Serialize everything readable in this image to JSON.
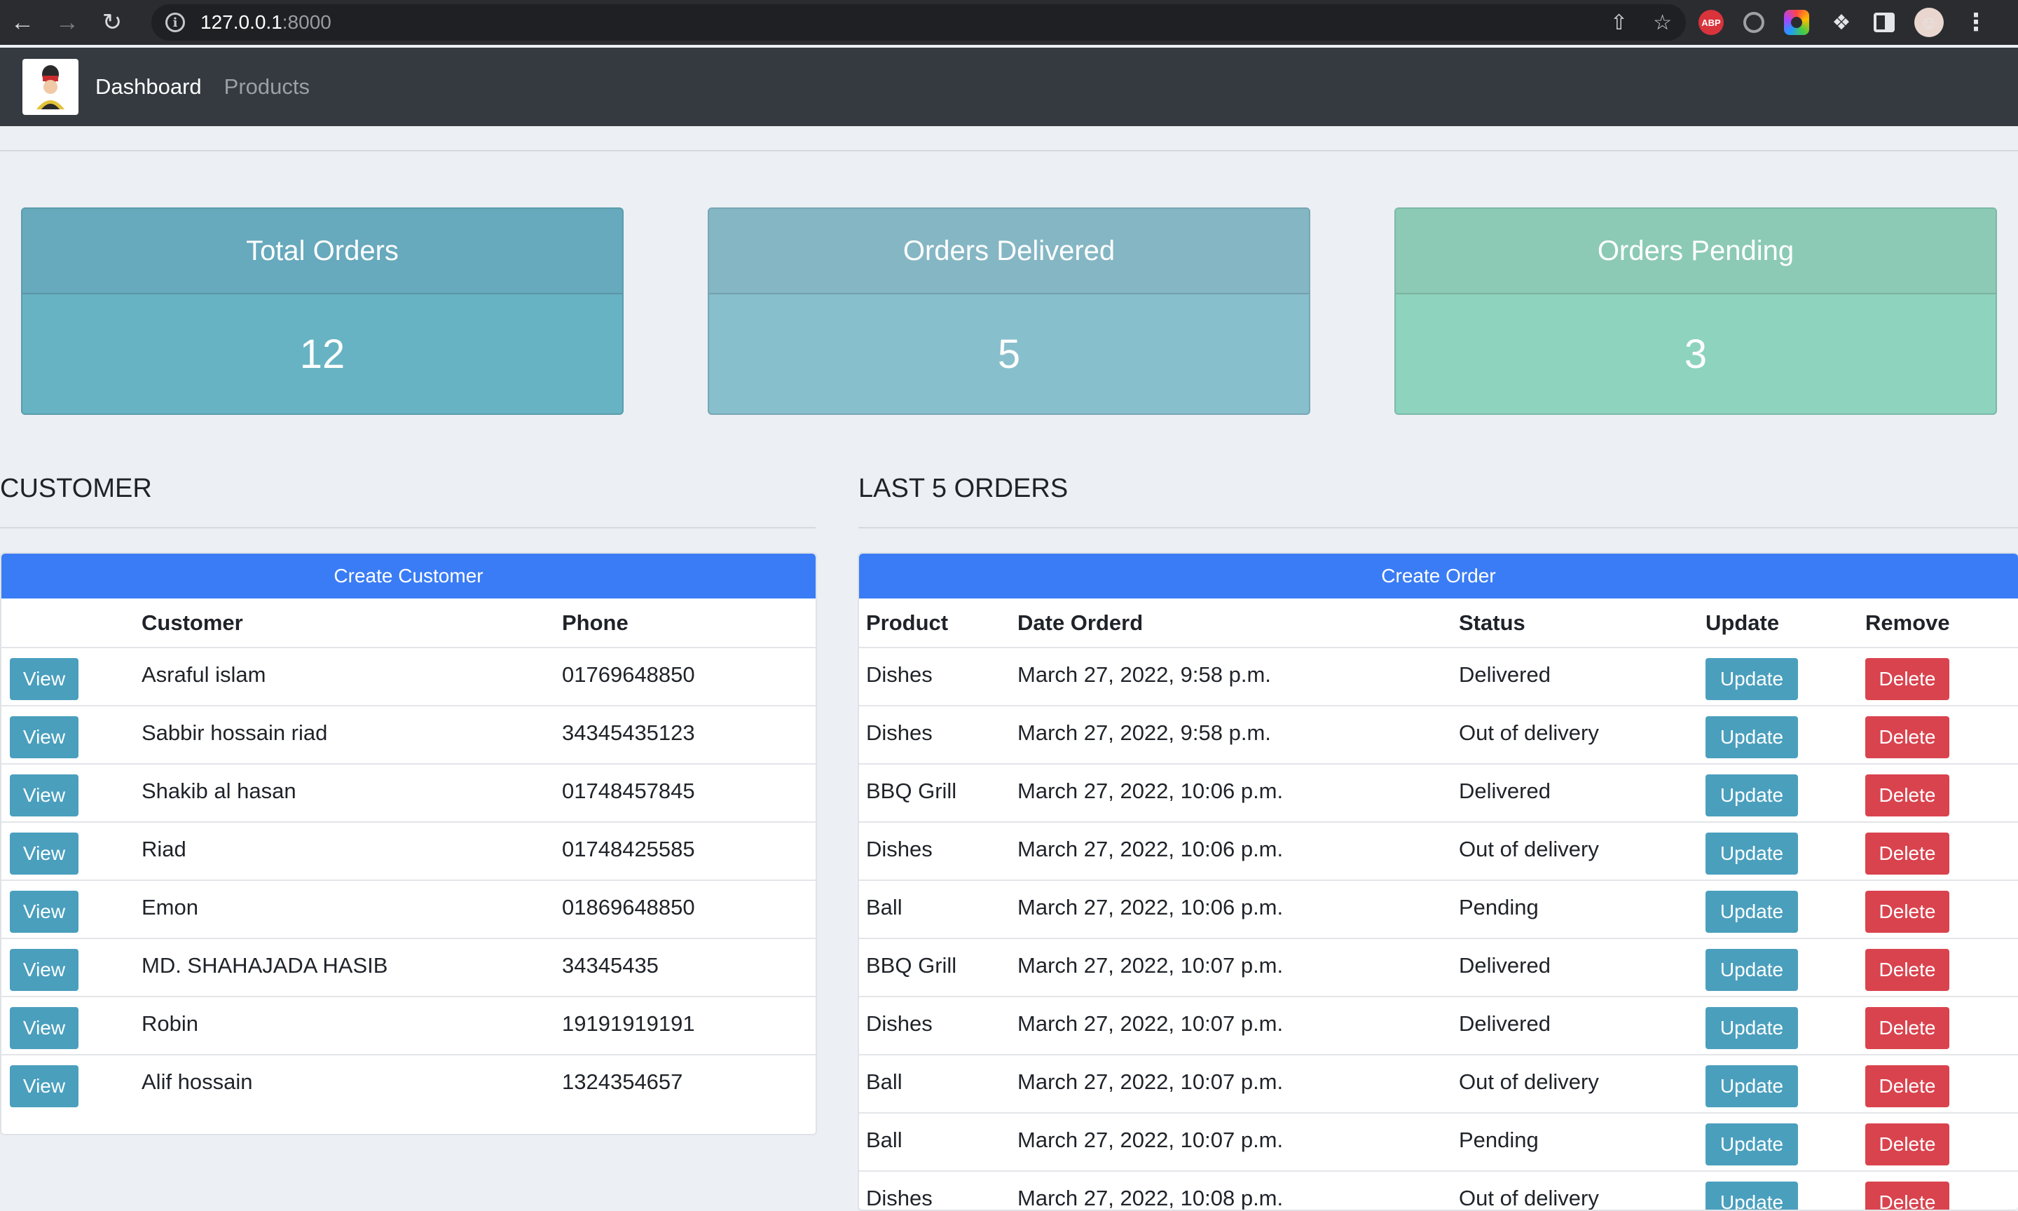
{
  "browser": {
    "url_host": "127.0.0.1",
    "url_port": ":8000",
    "abp_label": "ABP"
  },
  "navbar": {
    "links": [
      "Dashboard",
      "Products"
    ]
  },
  "stats": [
    {
      "title": "Total Orders",
      "value": "12"
    },
    {
      "title": "Orders Delivered",
      "value": "5"
    },
    {
      "title": "Orders Pending",
      "value": "3"
    }
  ],
  "customers": {
    "heading": "CUSTOMER",
    "create_label": "Create Customer",
    "columns": [
      "",
      "Customer",
      "Phone"
    ],
    "view_label": "View",
    "rows": [
      {
        "name": "Asraful islam",
        "phone": "01769648850"
      },
      {
        "name": "Sabbir hossain riad",
        "phone": "34345435123"
      },
      {
        "name": "Shakib al hasan",
        "phone": "01748457845"
      },
      {
        "name": "Riad",
        "phone": "01748425585"
      },
      {
        "name": "Emon",
        "phone": "01869648850"
      },
      {
        "name": "MD. SHAHAJADA HASIB",
        "phone": "34345435"
      },
      {
        "name": "Robin",
        "phone": "19191919191"
      },
      {
        "name": "Alif hossain",
        "phone": "1324354657"
      }
    ]
  },
  "orders": {
    "heading": "LAST 5 ORDERS",
    "create_label": "Create Order",
    "columns": [
      "Product",
      "Date Orderd",
      "Status",
      "Update",
      "Remove"
    ],
    "update_label": "Update",
    "delete_label": "Delete",
    "rows": [
      {
        "product": "Dishes",
        "date": "March 27, 2022, 9:58 p.m.",
        "status": "Delivered"
      },
      {
        "product": "Dishes",
        "date": "March 27, 2022, 9:58 p.m.",
        "status": "Out of delivery"
      },
      {
        "product": "BBQ Grill",
        "date": "March 27, 2022, 10:06 p.m.",
        "status": "Delivered"
      },
      {
        "product": "Dishes",
        "date": "March 27, 2022, 10:06 p.m.",
        "status": "Out of delivery"
      },
      {
        "product": "Ball",
        "date": "March 27, 2022, 10:06 p.m.",
        "status": "Pending"
      },
      {
        "product": "BBQ Grill",
        "date": "March 27, 2022, 10:07 p.m.",
        "status": "Delivered"
      },
      {
        "product": "Dishes",
        "date": "March 27, 2022, 10:07 p.m.",
        "status": "Delivered"
      },
      {
        "product": "Ball",
        "date": "March 27, 2022, 10:07 p.m.",
        "status": "Out of delivery"
      },
      {
        "product": "Ball",
        "date": "March 27, 2022, 10:07 p.m.",
        "status": "Pending"
      },
      {
        "product": "Dishes",
        "date": "March 27, 2022, 10:08 p.m.",
        "status": "Out of delivery"
      }
    ]
  },
  "colors": {
    "primary": "#3a7cf5",
    "info": "#4a9fbd",
    "danger": "#d9434e",
    "navbar": "#343a40"
  }
}
